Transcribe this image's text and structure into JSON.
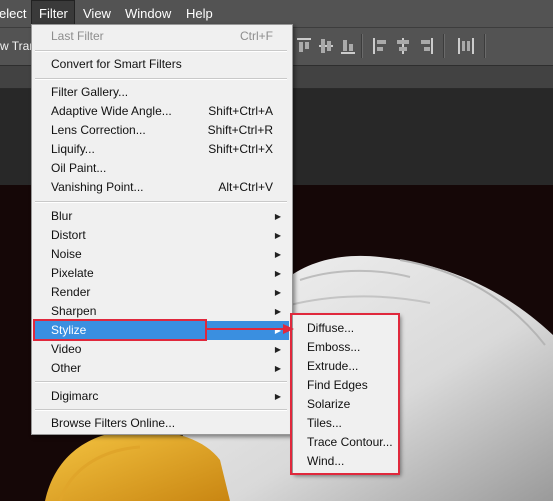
{
  "menubar": {
    "items": [
      {
        "label": "elect"
      },
      {
        "label": "Filter"
      },
      {
        "label": "View"
      },
      {
        "label": "Window"
      },
      {
        "label": "Help"
      }
    ]
  },
  "options_bar": {
    "transform_label": "w Trans"
  },
  "filter_menu": {
    "items": [
      {
        "label": "Last Filter",
        "shortcut": "Ctrl+F"
      },
      {
        "label": "Convert for Smart Filters"
      },
      {
        "label": "Filter Gallery..."
      },
      {
        "label": "Adaptive Wide Angle...",
        "shortcut": "Shift+Ctrl+A"
      },
      {
        "label": "Lens Correction...",
        "shortcut": "Shift+Ctrl+R"
      },
      {
        "label": "Liquify...",
        "shortcut": "Shift+Ctrl+X"
      },
      {
        "label": "Oil Paint..."
      },
      {
        "label": "Vanishing Point...",
        "shortcut": "Alt+Ctrl+V"
      },
      {
        "label": "Blur"
      },
      {
        "label": "Distort"
      },
      {
        "label": "Noise"
      },
      {
        "label": "Pixelate"
      },
      {
        "label": "Render"
      },
      {
        "label": "Sharpen"
      },
      {
        "label": "Stylize"
      },
      {
        "label": "Video"
      },
      {
        "label": "Other"
      },
      {
        "label": "Digimarc"
      },
      {
        "label": "Browse Filters Online..."
      }
    ]
  },
  "stylize_menu": {
    "items": [
      {
        "label": "Diffuse..."
      },
      {
        "label": "Emboss..."
      },
      {
        "label": "Extrude..."
      },
      {
        "label": "Find Edges"
      },
      {
        "label": "Solarize"
      },
      {
        "label": "Tiles..."
      },
      {
        "label": "Trace Contour..."
      },
      {
        "label": "Wind..."
      }
    ]
  },
  "colors": {
    "highlight": "#3a8fe0",
    "annotation": "#e0283c",
    "menu_bg": "#f0f0f0"
  },
  "icons": [
    "submenu-arrow-icon",
    "align-icon",
    "distribute-icon",
    "auto-align-icon"
  ]
}
